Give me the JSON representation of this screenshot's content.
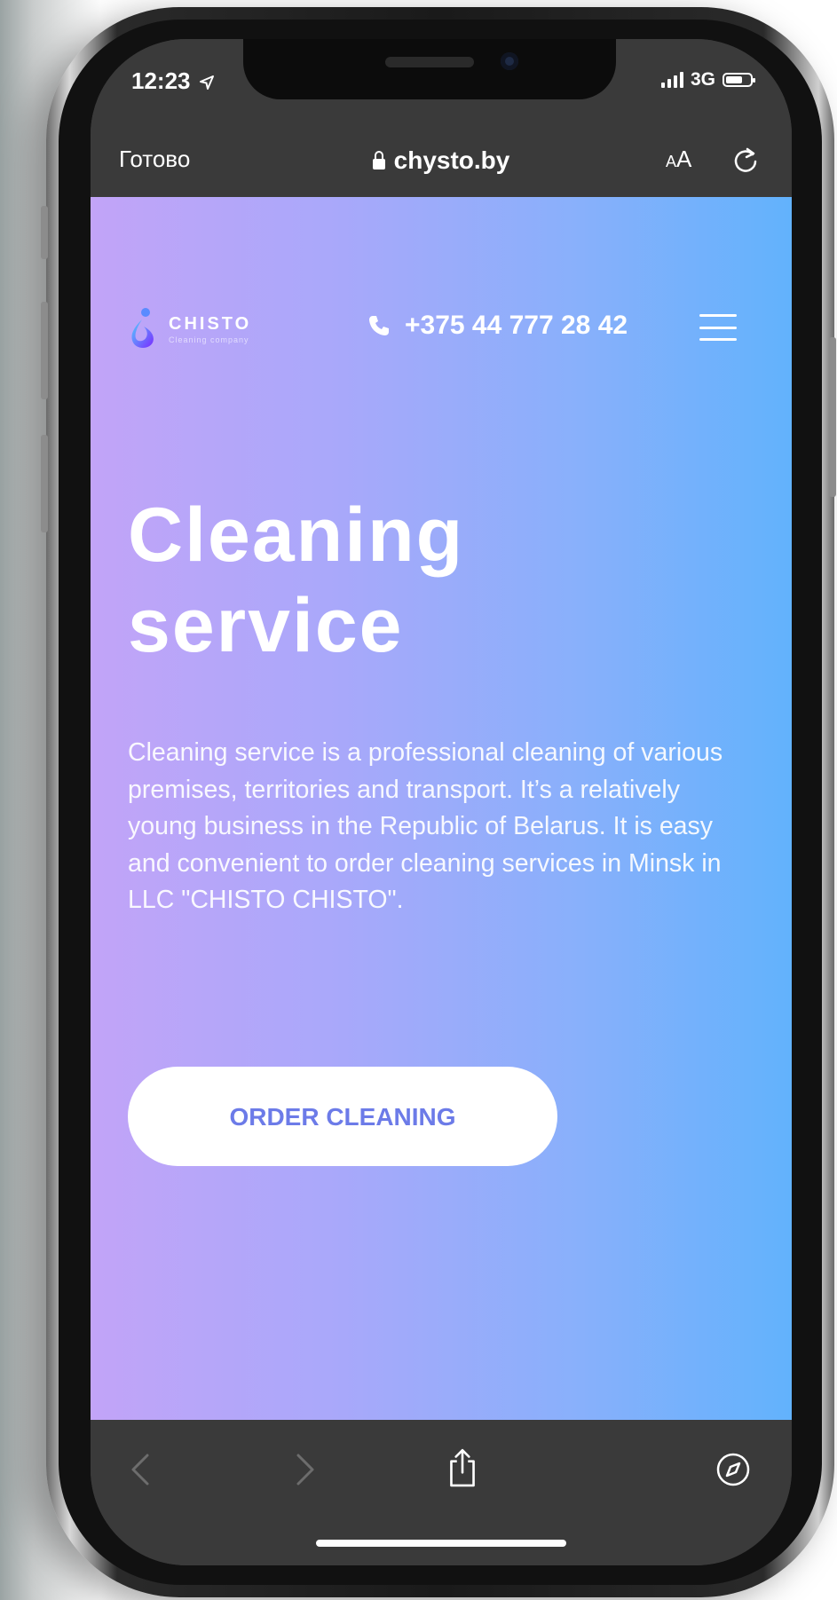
{
  "status_bar": {
    "time": "12:23",
    "network": "3G"
  },
  "browser": {
    "done_label": "Готово",
    "url": "chysto.by",
    "text_size_label": "AA"
  },
  "site_header": {
    "logo_name": "CHISTO",
    "logo_subtitle": "Cleaning company",
    "phone": "+375 44 777 28 42"
  },
  "hero": {
    "title": "Cleaning service",
    "description": "Cleaning service is a professional cleaning of various premises, territories and transport. It’s a relatively young business in the Republic of Belarus. It is easy and convenient to order cleaning services in Minsk in LLC \"CHISTO CHISTO\".",
    "cta_label": "ORDER CLEANING"
  },
  "colors": {
    "gradient_start": "#c2a4f8",
    "gradient_end": "#62b2fc",
    "cta_text": "#6c7be8",
    "browser_chrome": "#3a3a3a"
  },
  "icons": {
    "location": "location-arrow-icon",
    "lock": "lock-icon",
    "reload": "reload-icon",
    "phone": "phone-icon",
    "menu": "hamburger-menu-icon",
    "back": "chevron-left-icon",
    "forward": "chevron-right-icon",
    "share": "share-icon",
    "compass": "compass-icon"
  }
}
